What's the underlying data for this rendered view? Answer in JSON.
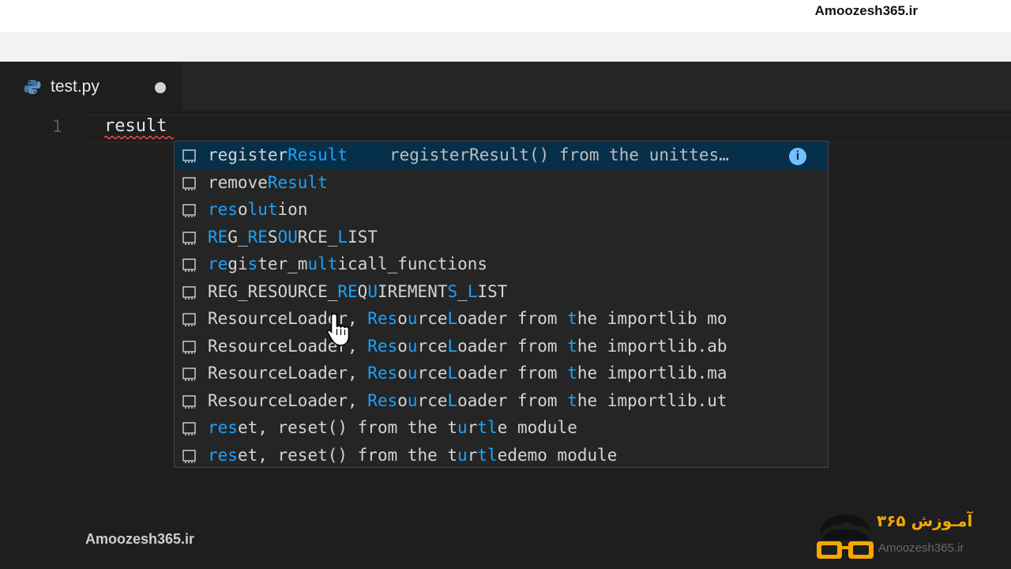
{
  "watermark": {
    "top": "Amoozesh365.ir",
    "bottom": "Amoozesh365.ir"
  },
  "tab": {
    "filename": "test.py",
    "icon": "python-icon",
    "unsaved": true
  },
  "editor": {
    "line_number": "1",
    "code": "result"
  },
  "suggestions": [
    {
      "label_parts": [
        {
          "t": "register",
          "m": false
        },
        {
          "t": "Result",
          "m": true
        }
      ],
      "detail": "registerResult() from the unittes…",
      "selected": true,
      "info": "i"
    },
    {
      "label_parts": [
        {
          "t": "remove",
          "m": false
        },
        {
          "t": "Result",
          "m": true
        }
      ],
      "detail": ""
    },
    {
      "label_parts": [
        {
          "t": "res",
          "m": true
        },
        {
          "t": "o",
          "m": false
        },
        {
          "t": "lut",
          "m": true
        },
        {
          "t": "ion",
          "m": false
        }
      ],
      "detail": ""
    },
    {
      "label_parts": [
        {
          "t": "RE",
          "m": true
        },
        {
          "t": "G_",
          "m": false
        },
        {
          "t": "RE",
          "m": true
        },
        {
          "t": "S",
          "m": false
        },
        {
          "t": "OU",
          "m": true
        },
        {
          "t": "RCE_",
          "m": false
        },
        {
          "t": "L",
          "m": true
        },
        {
          "t": "IST",
          "m": false
        }
      ],
      "detail": ""
    },
    {
      "label_parts": [
        {
          "t": "re",
          "m": true
        },
        {
          "t": "gi",
          "m": false
        },
        {
          "t": "s",
          "m": true
        },
        {
          "t": "ter_m",
          "m": false
        },
        {
          "t": "ult",
          "m": true
        },
        {
          "t": "icall_functions",
          "m": false
        }
      ],
      "detail": ""
    },
    {
      "label_parts": [
        {
          "t": "REG_RESOURCE_",
          "m": false
        },
        {
          "t": "RE",
          "m": true
        },
        {
          "t": "Q",
          "m": false
        },
        {
          "t": "U",
          "m": true
        },
        {
          "t": "IREMENT",
          "m": false
        },
        {
          "t": "S",
          "m": true
        },
        {
          "t": "_",
          "m": false
        },
        {
          "t": "L",
          "m": true
        },
        {
          "t": "IST",
          "m": false
        }
      ],
      "detail": ""
    },
    {
      "label_parts": [
        {
          "t": "ResourceLoader, ",
          "m": false
        },
        {
          "t": "Res",
          "m": true
        },
        {
          "t": "o",
          "m": false
        },
        {
          "t": "u",
          "m": true
        },
        {
          "t": "rce",
          "m": false
        },
        {
          "t": "L",
          "m": true
        },
        {
          "t": "oader from ",
          "m": false
        },
        {
          "t": "t",
          "m": true
        },
        {
          "t": "he importlib mo",
          "m": false
        }
      ],
      "detail": ""
    },
    {
      "label_parts": [
        {
          "t": "ResourceLoader, ",
          "m": false
        },
        {
          "t": "Res",
          "m": true
        },
        {
          "t": "o",
          "m": false
        },
        {
          "t": "u",
          "m": true
        },
        {
          "t": "rce",
          "m": false
        },
        {
          "t": "L",
          "m": true
        },
        {
          "t": "oader from ",
          "m": false
        },
        {
          "t": "t",
          "m": true
        },
        {
          "t": "he importlib.ab",
          "m": false
        }
      ],
      "detail": ""
    },
    {
      "label_parts": [
        {
          "t": "ResourceLoader, ",
          "m": false
        },
        {
          "t": "Res",
          "m": true
        },
        {
          "t": "o",
          "m": false
        },
        {
          "t": "u",
          "m": true
        },
        {
          "t": "rce",
          "m": false
        },
        {
          "t": "L",
          "m": true
        },
        {
          "t": "oader from ",
          "m": false
        },
        {
          "t": "t",
          "m": true
        },
        {
          "t": "he importlib.ma",
          "m": false
        }
      ],
      "detail": ""
    },
    {
      "label_parts": [
        {
          "t": "ResourceLoader, ",
          "m": false
        },
        {
          "t": "Res",
          "m": true
        },
        {
          "t": "o",
          "m": false
        },
        {
          "t": "u",
          "m": true
        },
        {
          "t": "rce",
          "m": false
        },
        {
          "t": "L",
          "m": true
        },
        {
          "t": "oader from ",
          "m": false
        },
        {
          "t": "t",
          "m": true
        },
        {
          "t": "he importlib.ut",
          "m": false
        }
      ],
      "detail": ""
    },
    {
      "label_parts": [
        {
          "t": "res",
          "m": true
        },
        {
          "t": "et, reset() from the t",
          "m": false
        },
        {
          "t": "u",
          "m": true
        },
        {
          "t": "r",
          "m": false
        },
        {
          "t": "tl",
          "m": true
        },
        {
          "t": "e module",
          "m": false
        }
      ],
      "detail": ""
    },
    {
      "label_parts": [
        {
          "t": "res",
          "m": true
        },
        {
          "t": "et, reset() from the t",
          "m": false
        },
        {
          "t": "u",
          "m": true
        },
        {
          "t": "r",
          "m": false
        },
        {
          "t": "tl",
          "m": true
        },
        {
          "t": "edemo module",
          "m": false
        }
      ],
      "detail": ""
    }
  ],
  "logo": {
    "brand": "آمـوزش ۳۶۵",
    "url": "Amoozesh365.ir"
  },
  "colors": {
    "match": "#18a3ff",
    "selected_bg": "#062f4a",
    "brand": "#f5a800"
  }
}
